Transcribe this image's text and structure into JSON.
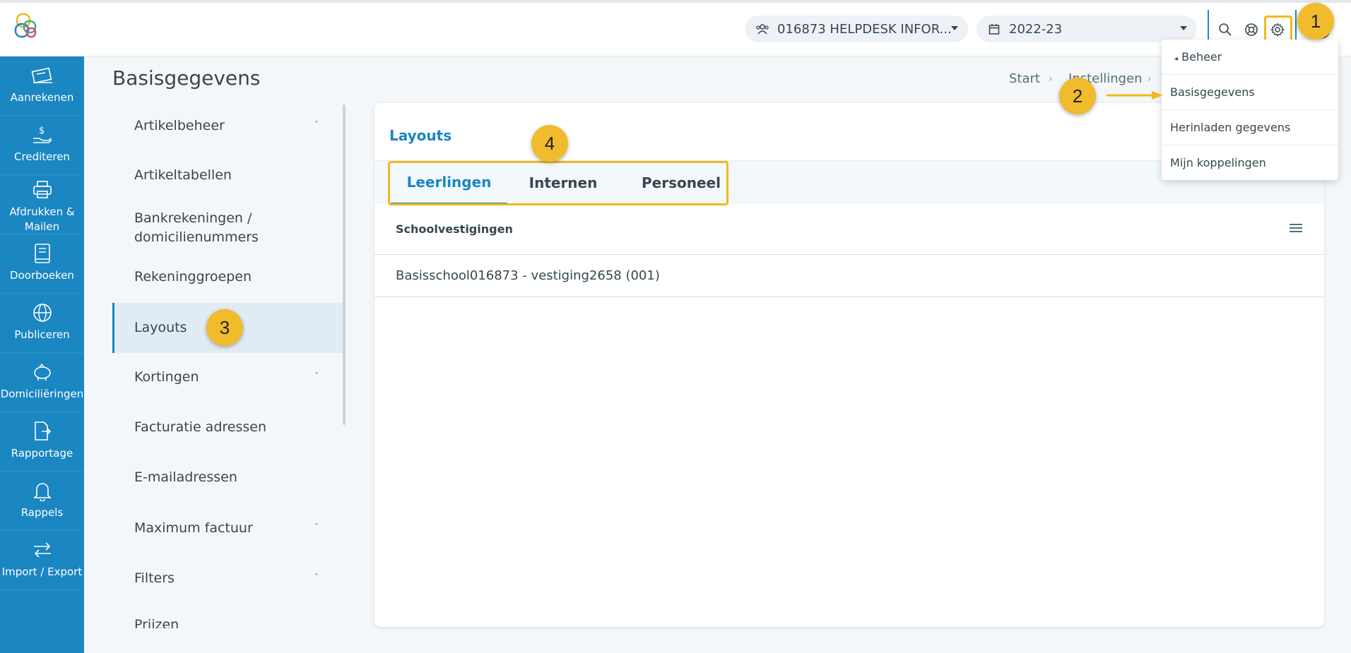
{
  "header": {
    "school_selector": "016873 HELPDESK INFOR...",
    "year_selector": "2022-23"
  },
  "sidebar": {
    "items": [
      {
        "label": "Aanrekenen",
        "icon": "invoice-icon"
      },
      {
        "label": "Crediteren",
        "icon": "hand-dollar-icon"
      },
      {
        "label": "Afdrukken & Mailen",
        "icon": "printer-icon"
      },
      {
        "label": "Doorboeken",
        "icon": "book-icon"
      },
      {
        "label": "Publiceren",
        "icon": "globe-icon"
      },
      {
        "label": "Domiciliëringen",
        "icon": "piggy-bank-icon"
      },
      {
        "label": "Rapportage",
        "icon": "export-file-icon"
      },
      {
        "label": "Rappels",
        "icon": "bell-icon"
      },
      {
        "label": "Import / Export",
        "icon": "arrows-icon"
      }
    ]
  },
  "page": {
    "title": "Basisgegevens",
    "breadcrumb": [
      "Start",
      "Instellingen"
    ]
  },
  "leftmenu": {
    "items": [
      {
        "label": "Artikelbeheer",
        "chevron": true
      },
      {
        "label": "Artikeltabellen",
        "chevron": false
      },
      {
        "label": "Bankrekeningen / domicilienummers",
        "line1": "Bankrekeningen /",
        "line2": "domicilienummers",
        "chevron": false
      },
      {
        "label": "Rekeninggroepen",
        "chevron": false
      },
      {
        "label": "Layouts",
        "chevron": false,
        "active": true
      },
      {
        "label": "Kortingen",
        "chevron": true
      },
      {
        "label": "Facturatie adressen",
        "chevron": false
      },
      {
        "label": "E-mailadressen",
        "chevron": false
      },
      {
        "label": "Maximum factuur",
        "chevron": true
      },
      {
        "label": "Filters",
        "chevron": true
      },
      {
        "label": "Prijzen",
        "chevron": false
      }
    ],
    "chevron_glyph": "ˇ"
  },
  "card": {
    "title": "Layouts",
    "tabs": [
      "Leerlingen",
      "Internen",
      "Personeel"
    ],
    "table_header": "Schoolvestigingen",
    "rows": [
      "Basisschool016873 - vestiging2658 (001)"
    ]
  },
  "dropdown": {
    "back_label": "Beheer",
    "items": [
      "Basisgegevens",
      "Herinladen gegevens",
      "Mijn koppelingen"
    ]
  },
  "annotations": {
    "badges": [
      "1",
      "2",
      "3",
      "4"
    ],
    "highlight_color": "#f2b81d"
  },
  "colors": {
    "primary": "#1a86c2",
    "badge": "#f0bc2d"
  }
}
